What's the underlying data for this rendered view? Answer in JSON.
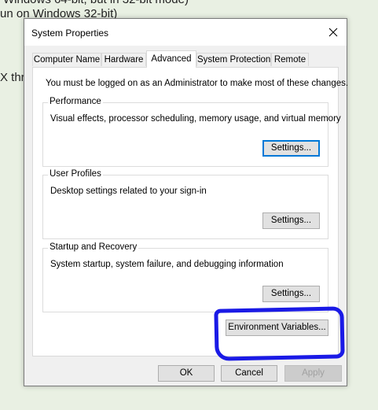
{
  "background": {
    "line1": "Windows 64-bit, but in 32-bit mode)",
    "line2": "un on Windows 32-bit)",
    "line3": "X thr"
  },
  "window": {
    "title": "System Properties",
    "close_icon": "close-icon",
    "tabs": [
      {
        "label": "Computer Name",
        "active": false
      },
      {
        "label": "Hardware",
        "active": false
      },
      {
        "label": "Advanced",
        "active": true
      },
      {
        "label": "System Protection",
        "active": false
      },
      {
        "label": "Remote",
        "active": false
      }
    ],
    "admin_note": "You must be logged on as an Administrator to make most of these changes.",
    "performance": {
      "title": "Performance",
      "description": "Visual effects, processor scheduling, memory usage, and virtual memory",
      "button": "Settings..."
    },
    "user_profiles": {
      "title": "User Profiles",
      "description": "Desktop settings related to your sign-in",
      "button": "Settings..."
    },
    "startup_recovery": {
      "title": "Startup and Recovery",
      "description": "System startup, system failure, and debugging information",
      "button": "Settings..."
    },
    "env_button": "Environment Variables...",
    "footer": {
      "ok": "OK",
      "cancel": "Cancel",
      "apply": "Apply"
    }
  },
  "colors": {
    "annotation": "#1a1ae6",
    "focus": "#0078d7"
  }
}
